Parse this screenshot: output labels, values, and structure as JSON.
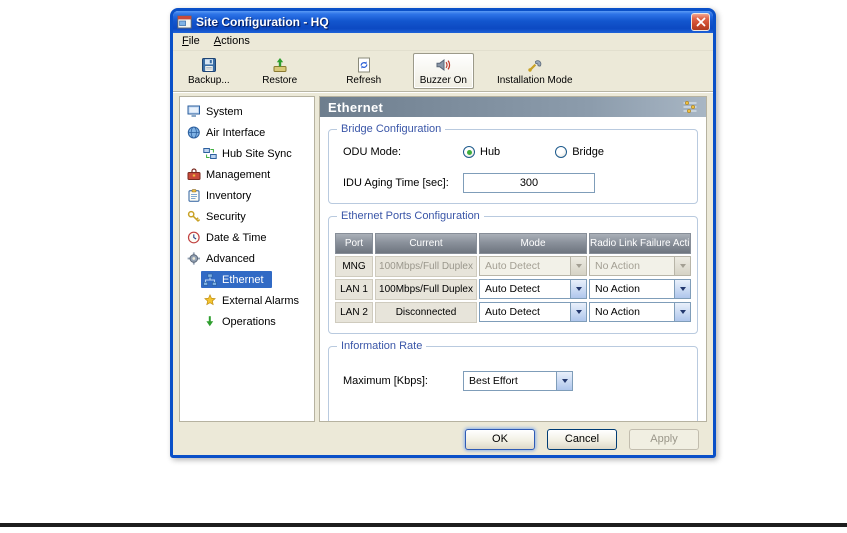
{
  "window": {
    "title": "Site Configuration - HQ",
    "icon": "window-icon",
    "close_icon": "close-icon"
  },
  "menu": {
    "items": [
      {
        "label": "File"
      },
      {
        "label": "Actions"
      }
    ]
  },
  "toolbar": {
    "buttons": [
      {
        "label": "Backup...",
        "icon": "backup-icon",
        "pressed": false
      },
      {
        "label": "Restore",
        "icon": "restore-icon",
        "pressed": false
      },
      {
        "label": "Refresh",
        "icon": "refresh-icon",
        "pressed": false
      },
      {
        "label": "Buzzer On",
        "icon": "buzzer-icon",
        "pressed": true
      },
      {
        "label": "Installation Mode",
        "icon": "installation-icon",
        "pressed": false
      }
    ]
  },
  "sidebar": {
    "items": [
      {
        "label": "System",
        "icon": "system-icon",
        "level": 0,
        "selected": false
      },
      {
        "label": "Air Interface",
        "icon": "air-interface-icon",
        "level": 0,
        "selected": false
      },
      {
        "label": "Hub Site Sync",
        "icon": "hub-site-sync-icon",
        "level": 1,
        "selected": false
      },
      {
        "label": "Management",
        "icon": "management-icon",
        "level": 0,
        "selected": false
      },
      {
        "label": "Inventory",
        "icon": "inventory-icon",
        "level": 0,
        "selected": false
      },
      {
        "label": "Security",
        "icon": "security-icon",
        "level": 0,
        "selected": false
      },
      {
        "label": "Date & Time",
        "icon": "date-time-icon",
        "level": 0,
        "selected": false
      },
      {
        "label": "Advanced",
        "icon": "advanced-icon",
        "level": 0,
        "selected": false
      },
      {
        "label": "Ethernet",
        "icon": "ethernet-icon",
        "level": 1,
        "selected": true
      },
      {
        "label": "External Alarms",
        "icon": "external-alarms-icon",
        "level": 1,
        "selected": false
      },
      {
        "label": "Operations",
        "icon": "operations-icon",
        "level": 1,
        "selected": false
      }
    ]
  },
  "main": {
    "header": "Ethernet",
    "header_icon": "levels-icon",
    "bridge": {
      "group_title": "Bridge Configuration",
      "odu_mode_label": "ODU Mode:",
      "options": [
        {
          "label": "Hub",
          "checked": true
        },
        {
          "label": "Bridge",
          "checked": false
        }
      ],
      "aging_label": "IDU Aging Time [sec]:",
      "aging_value": "300"
    },
    "ports": {
      "group_title": "Ethernet Ports Configuration",
      "columns": [
        "Port",
        "Current",
        "Mode",
        "Radio Link Failure Action"
      ],
      "rows": [
        {
          "port": "MNG",
          "current": "100Mbps/Full Duplex",
          "mode": "Auto Detect",
          "action": "No Action",
          "enabled": false
        },
        {
          "port": "LAN 1",
          "current": "100Mbps/Full Duplex",
          "mode": "Auto Detect",
          "action": "No Action",
          "enabled": true
        },
        {
          "port": "LAN 2",
          "current": "Disconnected",
          "mode": "Auto Detect",
          "action": "No Action",
          "enabled": true
        }
      ]
    },
    "rate": {
      "group_title": "Information Rate",
      "label": "Maximum [Kbps]:",
      "value": "Best Effort"
    }
  },
  "footer": {
    "buttons": [
      {
        "label": "OK",
        "enabled": true
      },
      {
        "label": "Cancel",
        "enabled": true
      },
      {
        "label": "Apply",
        "enabled": false
      }
    ]
  },
  "colors": {
    "titlebar_gradient_top": "#5A9AF5",
    "titlebar_gradient_bottom": "#0C49C2",
    "selection": "#316AC5",
    "window_chrome": "#ECE9D8",
    "group_title_text": "#3A56A8",
    "panel_header": "#8C9CAC"
  }
}
